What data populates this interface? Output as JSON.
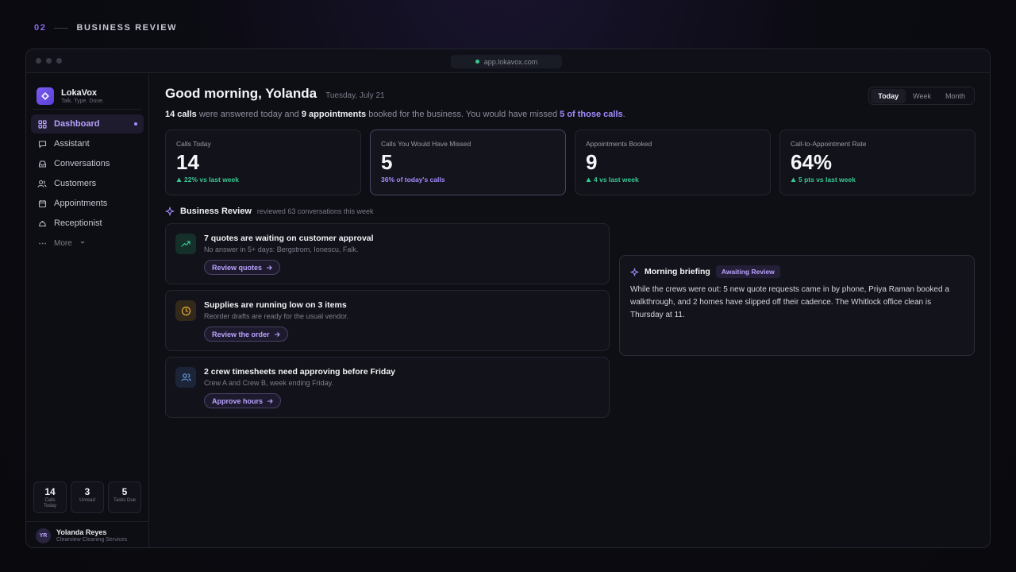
{
  "slide": {
    "number": "02",
    "title": "BUSINESS REVIEW"
  },
  "browser": {
    "url": "app.lokavox.com"
  },
  "brand": {
    "name": "LokaVox",
    "tagline": "Talk. Type. Done."
  },
  "nav": {
    "items": [
      {
        "label": "Dashboard",
        "icon": "grid-icon",
        "active": true
      },
      {
        "label": "Assistant",
        "icon": "chat-icon"
      },
      {
        "label": "Conversations",
        "icon": "inbox-icon"
      },
      {
        "label": "Customers",
        "icon": "users-icon"
      },
      {
        "label": "Appointments",
        "icon": "calendar-icon"
      },
      {
        "label": "Receptionist",
        "icon": "desk-bell-icon"
      }
    ],
    "more_label": "More"
  },
  "side_stats": [
    {
      "value": "14",
      "label": "Calls Today"
    },
    {
      "value": "3",
      "label": "Unread"
    },
    {
      "value": "5",
      "label": "Tasks Due"
    }
  ],
  "user": {
    "initials": "YR",
    "name": "Yolanda Reyes",
    "org": "Clearview Cleaning Services"
  },
  "header": {
    "greeting": "Good morning, Yolanda",
    "date": "Tuesday, July 21",
    "range_tabs": [
      "Today",
      "Week",
      "Month"
    ],
    "active_range": "Today"
  },
  "summary": {
    "calls": "14 calls",
    "text1": " were answered today and ",
    "appointments": "9 appointments",
    "text2": " booked for the business. You would have missed ",
    "missed": "5 of those calls",
    "text3": "."
  },
  "kpis": [
    {
      "label": "Calls Today",
      "value": "14",
      "delta": "22% vs last week",
      "delta_arrow": true
    },
    {
      "label": "Calls You Would Have Missed",
      "value": "5",
      "delta": "36% of today's calls",
      "delta_arrow": false
    },
    {
      "label": "Appointments Booked",
      "value": "9",
      "delta": "4 vs last week",
      "delta_arrow": true
    },
    {
      "label": "Call-to-Appointment Rate",
      "value": "64%",
      "delta": "5 pts vs last week",
      "delta_arrow": true
    }
  ],
  "business_review": {
    "title": "Business Review",
    "subtitle": "reviewed 63 conversations this week",
    "tasks": [
      {
        "icon": "trend-up-icon",
        "title": "7 quotes are waiting on customer approval",
        "desc": "No answer in 5+ days: Bergstrom, Ionescu, Falk.",
        "action": "Review quotes"
      },
      {
        "icon": "clock-icon",
        "title": "Supplies are running low on 3 items",
        "desc": "Reorder drafts are ready for the usual vendor.",
        "action": "Review the order"
      },
      {
        "icon": "users-icon",
        "title": "2 crew timesheets need approving before Friday",
        "desc": "Crew A and Crew B, week ending Friday.",
        "action": "Approve hours"
      }
    ]
  },
  "briefing": {
    "title": "Morning briefing",
    "badge": "Awaiting Review",
    "body": "While the crews were out: 5 new quote requests came in by phone, Priya Raman booked a walkthrough, and 2 homes have slipped off their cadence. The Whitlock office clean is Thursday at 11."
  },
  "colors": {
    "accent": "#a58bff",
    "positive": "#38c793",
    "warning": "#e0a93a",
    "info": "#6fa3f0"
  }
}
